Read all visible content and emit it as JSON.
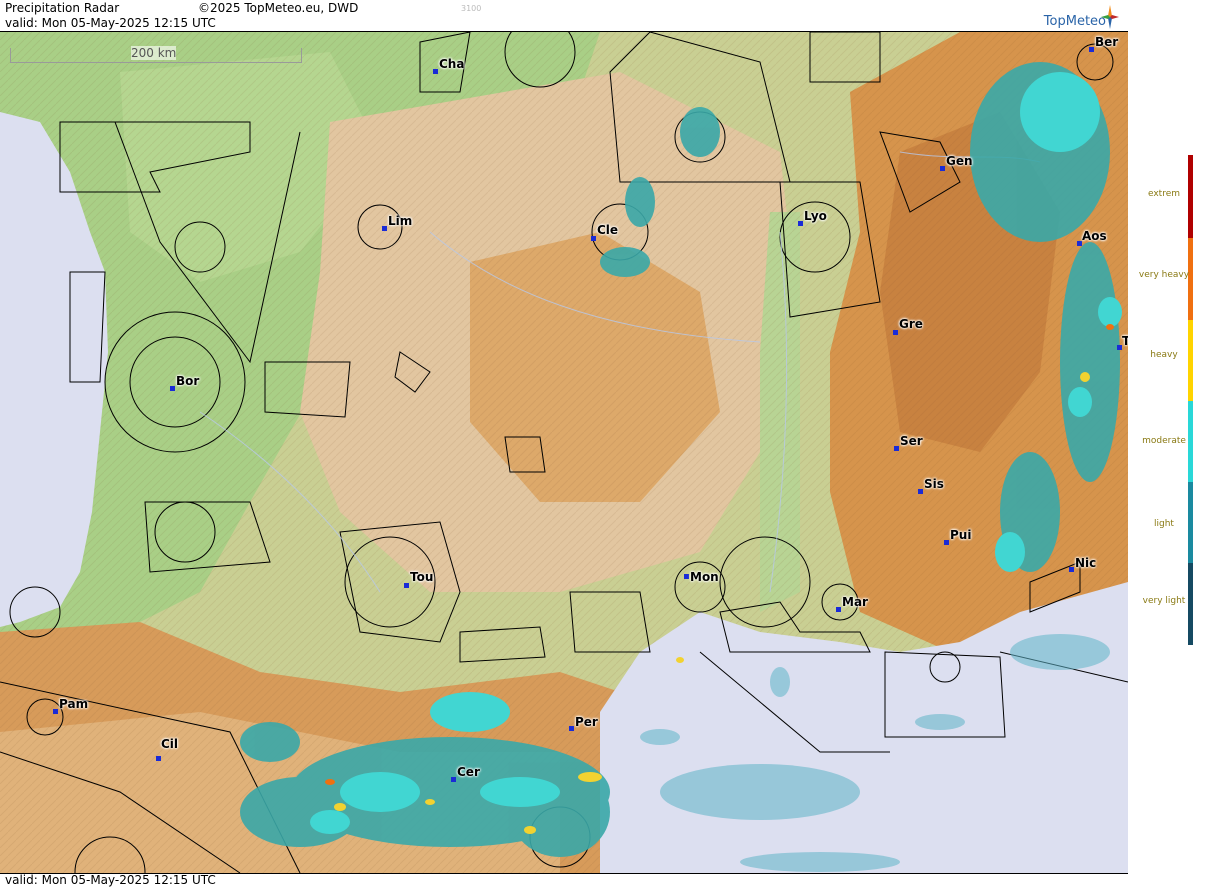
{
  "header": {
    "title": "Precipitation Radar",
    "copyright": "©2025 TopMeteo.eu, DWD",
    "valid": "valid:  Mon  05-May-2025 12:15 UTC",
    "faint_code": "3100",
    "brand": "TopMeteo"
  },
  "footer": {
    "valid": "valid:  Mon  05-May-2025 12:15 UTC"
  },
  "map": {
    "scale_label": "200 km",
    "cities": [
      "Cha",
      "Lim",
      "Cle",
      "Lyo",
      "Gen",
      "Ber",
      "Aos",
      "Gre",
      "Bor",
      "Ser",
      "Sis",
      "Pui",
      "Tou",
      "Mon",
      "Mar",
      "Nic",
      "Pam",
      "Cil",
      "Per",
      "Cer",
      "T"
    ]
  },
  "legend": {
    "levels": [
      {
        "label": "extrem",
        "color": "#b00000"
      },
      {
        "label": "very heavy",
        "color": "#f07010"
      },
      {
        "label": "heavy",
        "color": "#ffd400"
      },
      {
        "label": "moderate",
        "color": "#29d8d8"
      },
      {
        "label": "light",
        "color": "#1a8aa0"
      },
      {
        "label": "very light",
        "color": "#154a62"
      }
    ]
  },
  "colors": {
    "sea": "#dcdff0",
    "lowland": "#a9cf86",
    "hills": "#e6c79c",
    "mountains": "#d9964e",
    "rain_light": "#3aa8a8",
    "rain_moderate": "#41d6d2",
    "rain_heavy": "#f2d230"
  }
}
